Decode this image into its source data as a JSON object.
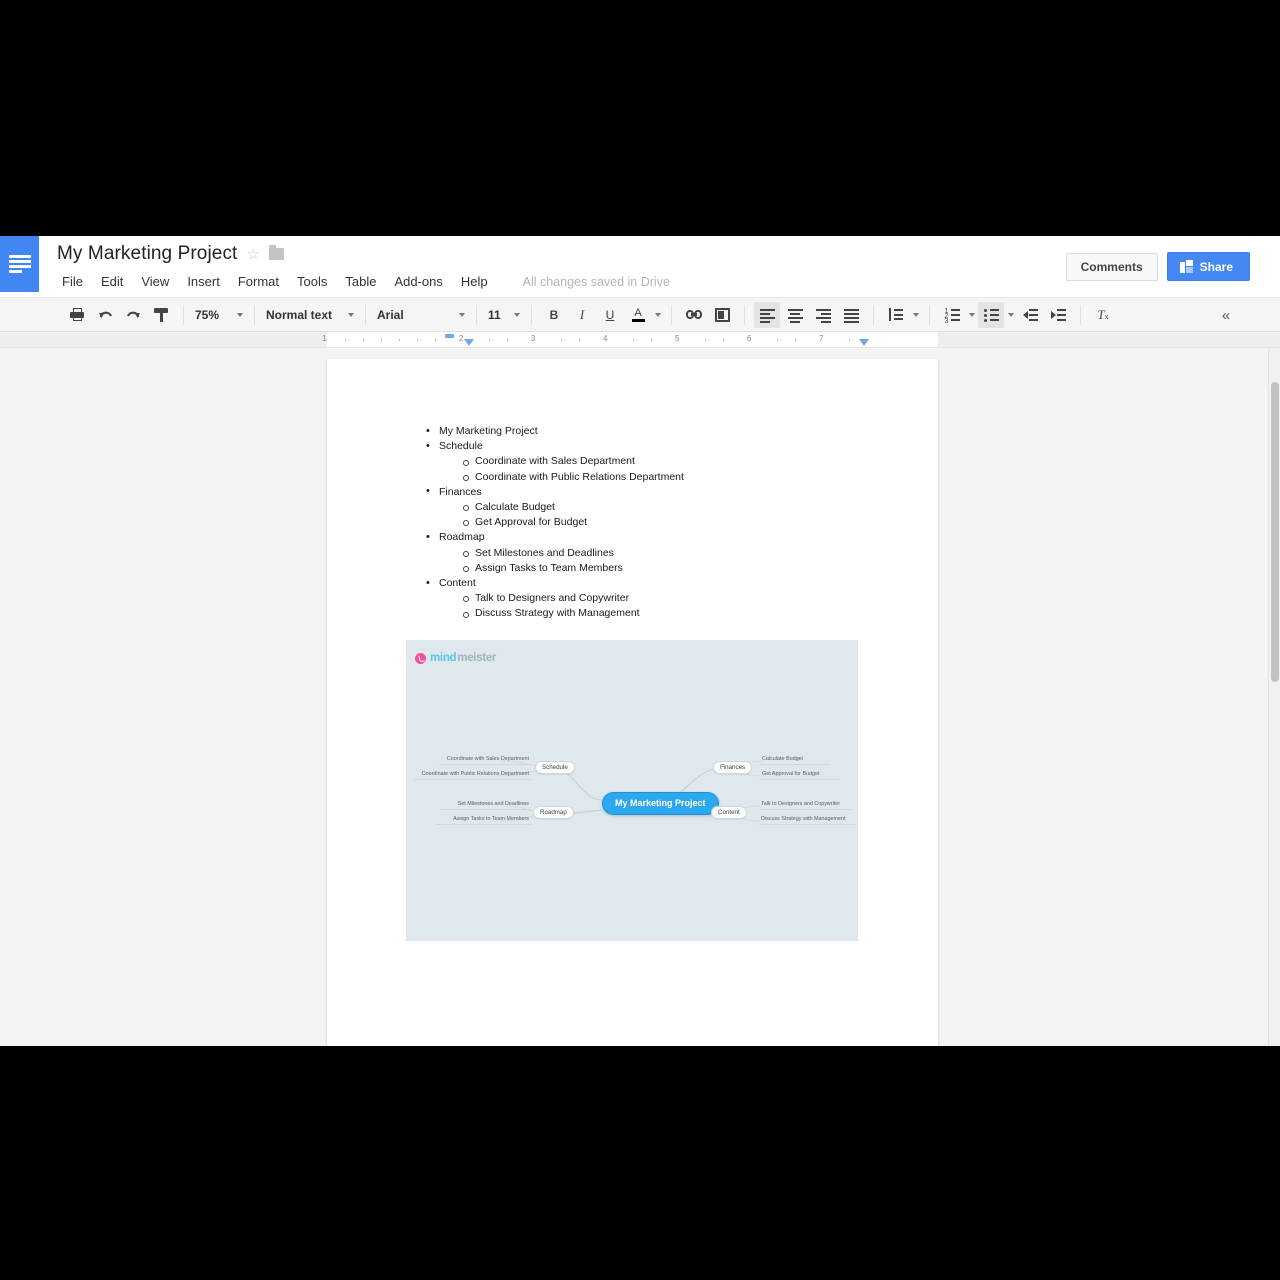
{
  "app": {
    "logo_icon": "google-docs-icon",
    "doc_title": "My Marketing Project",
    "star_icon": "☆",
    "folder_icon": "folder-icon",
    "save_status": "All changes saved in Drive"
  },
  "menubar": {
    "items": [
      {
        "label": "File"
      },
      {
        "label": "Edit"
      },
      {
        "label": "View"
      },
      {
        "label": "Insert"
      },
      {
        "label": "Format"
      },
      {
        "label": "Tools"
      },
      {
        "label": "Table"
      },
      {
        "label": "Add-ons"
      },
      {
        "label": "Help"
      }
    ]
  },
  "header_actions": {
    "comments_label": "Comments",
    "share_label": "Share",
    "share_color": "#4688f1"
  },
  "toolbar": {
    "zoom_value": "75%",
    "style_value": "Normal text",
    "font_value": "Arial",
    "size_value": "11",
    "bold_label": "B",
    "italic_label": "I",
    "underline_label": "U",
    "text_color_label": "A",
    "clear_format_label": "T",
    "collapse_label": "«"
  },
  "ruler": {
    "numbers": [
      "1",
      "2",
      "3",
      "4",
      "5",
      "6",
      "7"
    ]
  },
  "document": {
    "list": [
      {
        "level": 1,
        "text": "My Marketing Project"
      },
      {
        "level": 1,
        "text": "Schedule"
      },
      {
        "level": 2,
        "text": "Coordinate with Sales Department"
      },
      {
        "level": 2,
        "text": "Coordinate with Public Relations Department"
      },
      {
        "level": 1,
        "text": "Finances"
      },
      {
        "level": 2,
        "text": "Calculate Budget"
      },
      {
        "level": 2,
        "text": "Get Approval for Budget"
      },
      {
        "level": 1,
        "text": "Roadmap"
      },
      {
        "level": 2,
        "text": "Set Milestones and Deadlines"
      },
      {
        "level": 2,
        "text": "Assign Tasks to Team Members"
      },
      {
        "level": 1,
        "text": "Content"
      },
      {
        "level": 2,
        "text": "Talk to Designers and Copywriter"
      },
      {
        "level": 2,
        "text": "Discuss Strategy with Management"
      }
    ]
  },
  "mindmap": {
    "brand_part1": "mind",
    "brand_part2": "meister",
    "background_color": "#dfe8ed",
    "center_color": "#2ca8ef",
    "center": "My Marketing Project",
    "branches": [
      {
        "name": "Schedule",
        "side": "left",
        "row": "top",
        "leaves": [
          "Coordinate with Sales Department",
          "Coordinate with Public Relations Department"
        ]
      },
      {
        "name": "Finances",
        "side": "right",
        "row": "top",
        "leaves": [
          "Calculate Budget",
          "Get Approval for Budget"
        ]
      },
      {
        "name": "Roadmap",
        "side": "left",
        "row": "bottom",
        "leaves": [
          "Set Milestones and Deadlines",
          "Assign Tasks to Team Members"
        ]
      },
      {
        "name": "Content",
        "side": "right",
        "row": "bottom",
        "leaves": [
          "Talk to Designers and Copywriter",
          "Discuss Strategy with Management"
        ]
      }
    ]
  }
}
